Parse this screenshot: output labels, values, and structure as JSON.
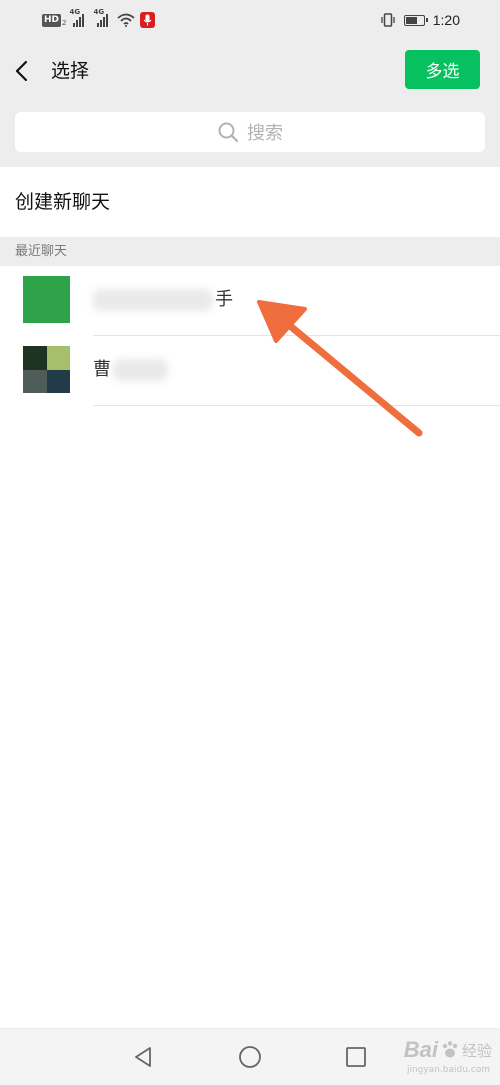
{
  "status_bar": {
    "network_badge": "HD",
    "network_badge_sub": "2",
    "signal1_label": "4G",
    "signal2_label": "4G",
    "time": "1:20",
    "battery_level": 0.7,
    "icons": [
      "hd-icon",
      "signal-icon",
      "signal-icon",
      "wifi-icon",
      "microphone-icon",
      "vibrate-icon",
      "battery-icon"
    ]
  },
  "header": {
    "title": "选择",
    "multi_select_label": "多选",
    "accent_color": "#07c160"
  },
  "search": {
    "placeholder": "搜索"
  },
  "create_chat": {
    "label": "创建新聊天"
  },
  "recent": {
    "section_label": "最近聊天",
    "chats": [
      {
        "name_visible": "手",
        "avatar_color": "#2ea34a"
      },
      {
        "name_visible": "曹",
        "avatar_colors": [
          "#1f3322",
          "#a6bf6a",
          "#4f5d5a",
          "#213b48"
        ]
      }
    ]
  },
  "nav_bar": {
    "buttons": [
      "back-triangle-icon",
      "home-circle-icon",
      "recents-square-icon"
    ]
  },
  "watermark": {
    "brand": "Bai",
    "text": "经验",
    "domain": "jingyan.baidu.com"
  },
  "annotation": {
    "arrow_color": "#f06d3d"
  }
}
